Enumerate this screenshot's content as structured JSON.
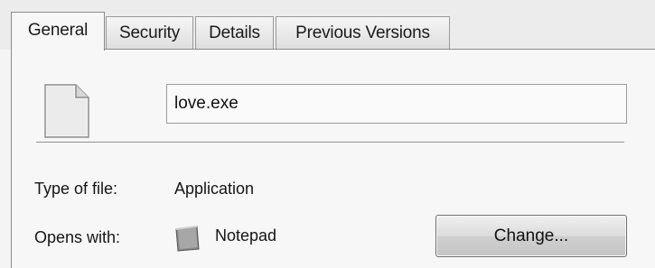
{
  "tabs": [
    {
      "label": "General",
      "active": true
    },
    {
      "label": "Security",
      "active": false
    },
    {
      "label": "Details",
      "active": false
    },
    {
      "label": "Previous Versions",
      "active": false
    }
  ],
  "file": {
    "icon": "generic-file-icon",
    "name": "love.exe"
  },
  "properties": {
    "type_label": "Type of file:",
    "type_value": "Application",
    "opens_label": "Opens with:",
    "opens_icon": "notepad-icon",
    "opens_value": "Notepad",
    "change_label": "Change..."
  }
}
